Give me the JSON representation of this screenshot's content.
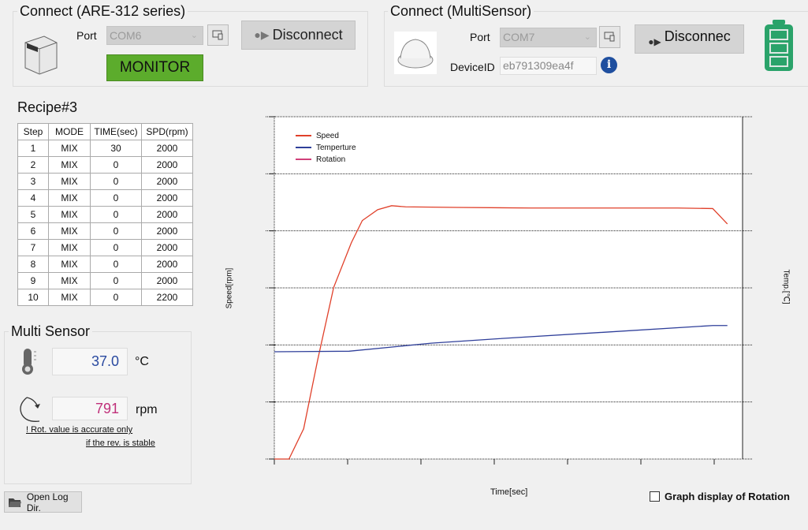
{
  "are": {
    "title": "Connect (ARE-312 series)",
    "port_label": "Port",
    "port_value": "COM6",
    "disconnect_label": "Disconnect",
    "monitor_label": "MONITOR"
  },
  "ms_connect": {
    "title": "Connect (MultiSensor)",
    "port_label": "Port",
    "port_value": "COM7",
    "device_id_label": "DeviceID",
    "device_id_value": "eb791309ea4f",
    "disconnect_label": "Disconnec"
  },
  "recipe": {
    "title": "Recipe#3",
    "columns": [
      "Step",
      "MODE",
      "TIME(sec)",
      "SPD(rpm)"
    ],
    "rows": [
      [
        "1",
        "MIX",
        "30",
        "2000"
      ],
      [
        "2",
        "MIX",
        "0",
        "2000"
      ],
      [
        "3",
        "MIX",
        "0",
        "2000"
      ],
      [
        "4",
        "MIX",
        "0",
        "2000"
      ],
      [
        "5",
        "MIX",
        "0",
        "2000"
      ],
      [
        "6",
        "MIX",
        "0",
        "2000"
      ],
      [
        "7",
        "MIX",
        "0",
        "2000"
      ],
      [
        "8",
        "MIX",
        "0",
        "2000"
      ],
      [
        "9",
        "MIX",
        "0",
        "2000"
      ],
      [
        "10",
        "MIX",
        "0",
        "2200"
      ]
    ]
  },
  "sensor": {
    "title": "Multi Sensor",
    "temp_value": "37.0",
    "temp_unit": "°C",
    "rot_value": "791",
    "rot_unit": "rpm",
    "note1": "! Rot. value is accurate only",
    "note2": "if the rev. is stable"
  },
  "open_log_label": "Open Log Dir.",
  "rotation_checkbox_label": "Graph display of Rotation",
  "rotation_checkbox_checked": false,
  "colors": {
    "speed": "#e0402a",
    "temp": "#2f3f9a",
    "rotation": "#d0407a",
    "monitor": "#5cac2c",
    "battery": "#2aa36a",
    "temp_text": "#2a4aa0",
    "rot_text": "#c0307a"
  },
  "chart_data": {
    "type": "line",
    "xlabel": "Time[sec]",
    "ylabel": "Speed[rpm]",
    "y2label": "Temp.[℃]",
    "xlim": [
      0,
      6.4
    ],
    "ylim": [
      0,
      3000
    ],
    "y2lim": [
      0,
      6
    ],
    "x_ticks": [
      0,
      1,
      2,
      3,
      4,
      5,
      6
    ],
    "grid": true,
    "legend": "top-left",
    "legend_entries": [
      "Speed",
      "Temperture",
      "Rotation"
    ],
    "series": [
      {
        "name": "Speed",
        "axis": "y",
        "x": [
          0,
          0.2,
          0.4,
          0.59,
          0.81,
          1.05,
          1.2,
          1.41,
          1.6,
          1.79,
          2.5,
          3.5,
          4.5,
          5.5,
          5.98,
          6.18
        ],
        "y": [
          0,
          0,
          265,
          865,
          1505,
          1895,
          2090,
          2185,
          2220,
          2210,
          2205,
          2200,
          2200,
          2200,
          2195,
          2060
        ]
      },
      {
        "name": "Temperture",
        "axis": "y2",
        "x": [
          0,
          1.02,
          2.14,
          3.07,
          4.47,
          5.98,
          6.18
        ],
        "y": [
          1.88,
          1.89,
          2.03,
          2.11,
          2.22,
          2.34,
          2.34
        ]
      },
      {
        "name": "Rotation",
        "axis": "y",
        "x": [],
        "y": []
      }
    ]
  }
}
